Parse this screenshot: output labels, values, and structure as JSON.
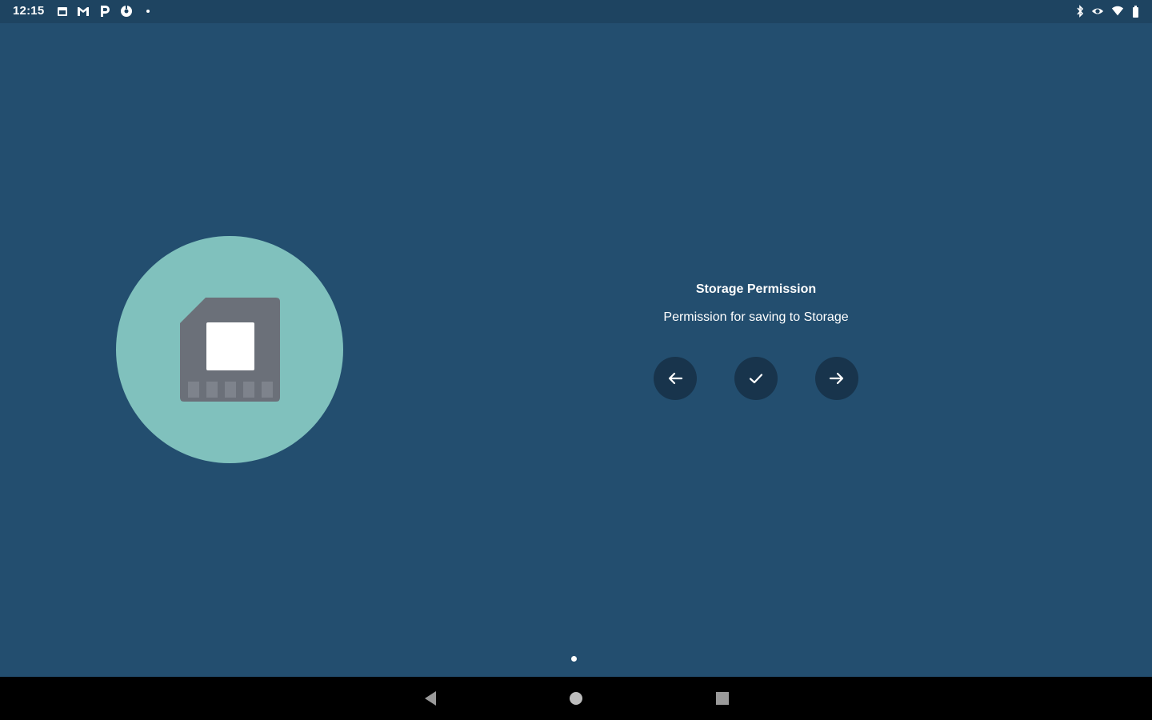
{
  "status_bar": {
    "time": "12:15",
    "left_icons": [
      "calendar-icon",
      "gmail-icon",
      "pocket-casts-icon",
      "settings-app-icon",
      "more-dot-icon"
    ],
    "right_icons": [
      "bluetooth-icon",
      "eye-icon",
      "wifi-icon",
      "battery-icon"
    ]
  },
  "onboarding": {
    "illustration": "sd-card-icon",
    "title": "Storage Permission",
    "subtitle": "Permission for saving to Storage",
    "buttons": [
      "arrow-left-icon",
      "check-icon",
      "arrow-right-icon"
    ],
    "page_indicator": {
      "pages": 1,
      "current": 1
    }
  },
  "nav_bar": {
    "buttons": [
      "back-icon",
      "home-icon",
      "recents-icon"
    ]
  },
  "colors": {
    "background": "#234e6f",
    "status_bar": "#1e4461",
    "circle": "#80c1bd",
    "card": "#6b7079",
    "button": "#18344c",
    "text": "#ffffff"
  }
}
